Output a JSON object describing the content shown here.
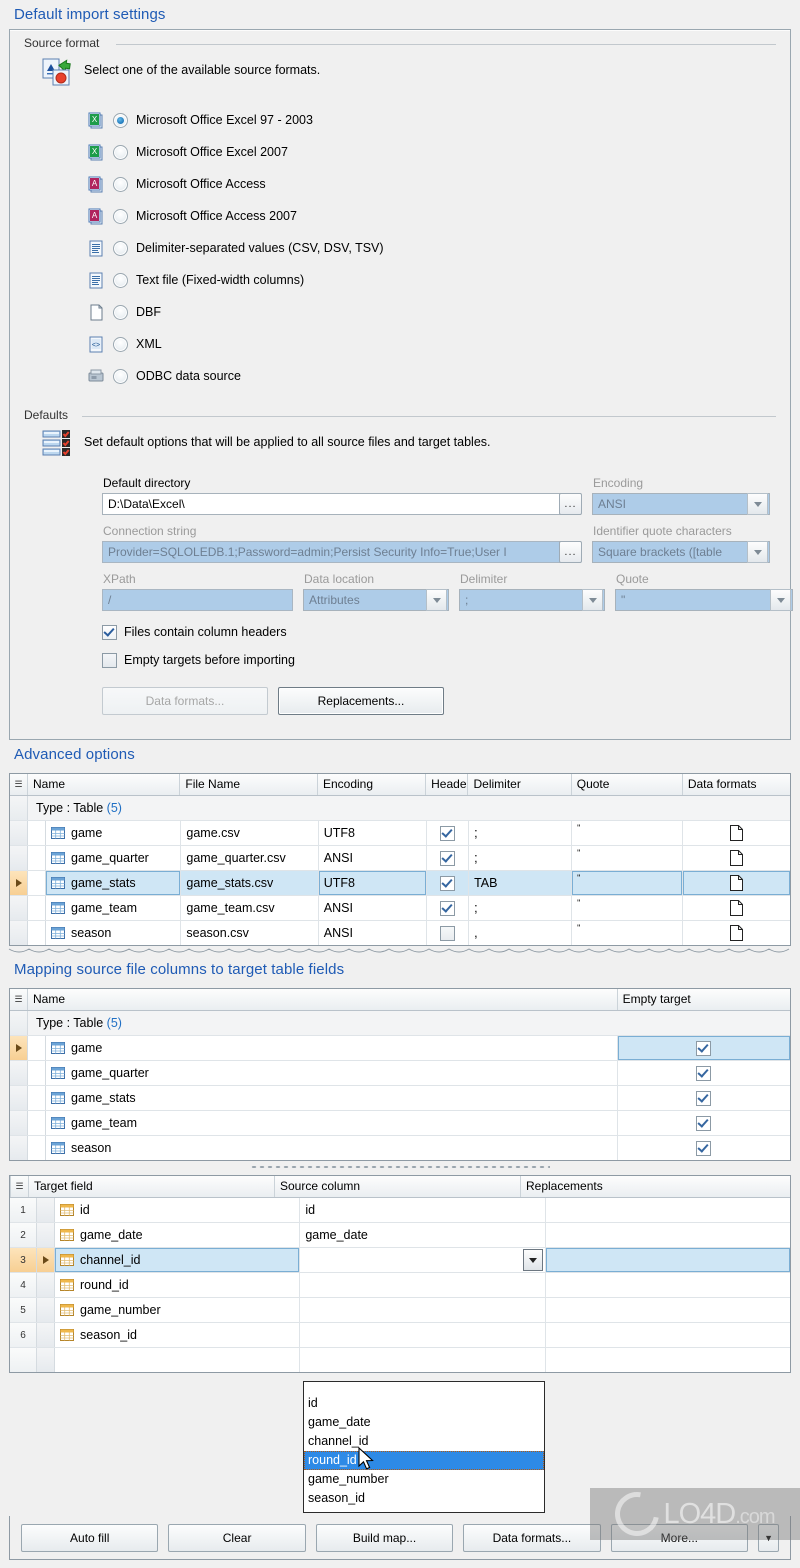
{
  "page": {
    "title": "Default import settings",
    "advanced_title": "Advanced options",
    "mapping_title": "Mapping source file columns to target table fields"
  },
  "source_format": {
    "group_label": "Source format",
    "hint": "Select one of the available source formats.",
    "options": [
      {
        "label": "Microsoft Office Excel 97 - 2003",
        "icon": "excel-icon",
        "selected": true
      },
      {
        "label": "Microsoft Office Excel 2007",
        "icon": "excel-icon",
        "selected": false
      },
      {
        "label": "Microsoft Office Access",
        "icon": "access-icon",
        "selected": false
      },
      {
        "label": "Microsoft Office Access 2007",
        "icon": "access-icon",
        "selected": false
      },
      {
        "label": "Delimiter-separated values (CSV, DSV, TSV)",
        "icon": "textfile-icon",
        "selected": false
      },
      {
        "label": "Text file (Fixed-width columns)",
        "icon": "textfile-icon",
        "selected": false
      },
      {
        "label": "DBF",
        "icon": "blankfile-icon",
        "selected": false
      },
      {
        "label": "XML",
        "icon": "xml-icon",
        "selected": false
      },
      {
        "label": "ODBC data source",
        "icon": "odbc-icon",
        "selected": false
      }
    ]
  },
  "defaults": {
    "group_label": "Defaults",
    "hint": "Set default options that will be applied to all source files and target tables.",
    "default_directory": {
      "label": "Default directory",
      "value": "D:\\Data\\Excel\\",
      "browse": "..."
    },
    "encoding": {
      "label": "Encoding",
      "value": "ANSI"
    },
    "connection_string": {
      "label": "Connection string",
      "value": "Provider=SQLOLEDB.1;Password=admin;Persist Security Info=True;User I",
      "browse": "..."
    },
    "identifier_quote": {
      "label": "Identifier quote characters",
      "value": "Square brackets ([table"
    },
    "xpath": {
      "label": "XPath",
      "value": "/"
    },
    "data_location": {
      "label": "Data location",
      "value": "Attributes"
    },
    "delimiter": {
      "label": "Delimiter",
      "value": ";"
    },
    "quote": {
      "label": "Quote",
      "value": "\""
    },
    "checkbox_headers": {
      "label": "Files contain column headers",
      "checked": true
    },
    "checkbox_empty": {
      "label": "Empty targets before importing",
      "checked": false
    },
    "button_data_formats": "Data formats...",
    "button_replacements": "Replacements..."
  },
  "advanced_grid": {
    "columns": [
      "Name",
      "File Name",
      "Encoding",
      "Heade",
      "Delimiter",
      "Quote",
      "Data formats"
    ],
    "group_row": {
      "text": "Type : Table",
      "count": "(5)"
    },
    "rows": [
      {
        "name": "game",
        "file": "game.csv",
        "encoding": "UTF8",
        "header": true,
        "delimiter": ";",
        "quote": "\"",
        "selected": false
      },
      {
        "name": "game_quarter",
        "file": "game_quarter.csv",
        "encoding": "ANSI",
        "header": true,
        "delimiter": ";",
        "quote": "\"",
        "selected": false
      },
      {
        "name": "game_stats",
        "file": "game_stats.csv",
        "encoding": "UTF8",
        "header": true,
        "delimiter": "TAB",
        "quote": "\"",
        "selected": true
      },
      {
        "name": "game_team",
        "file": "game_team.csv",
        "encoding": "ANSI",
        "header": true,
        "delimiter": ";",
        "quote": "\"",
        "selected": false
      },
      {
        "name": "season",
        "file": "season.csv",
        "encoding": "ANSI",
        "header": false,
        "delimiter": ",",
        "quote": "\"",
        "selected": false
      }
    ]
  },
  "mapping_grid": {
    "columns": [
      "Name",
      "Empty target"
    ],
    "group_row": {
      "text": "Type : Table",
      "count": "(5)"
    },
    "rows": [
      {
        "name": "game",
        "empty_target": true,
        "selected": true
      },
      {
        "name": "game_quarter",
        "empty_target": true,
        "selected": false
      },
      {
        "name": "game_stats",
        "empty_target": true,
        "selected": false
      },
      {
        "name": "game_team",
        "empty_target": true,
        "selected": false
      },
      {
        "name": "season",
        "empty_target": true,
        "selected": false
      }
    ]
  },
  "field_grid": {
    "columns": [
      "Target field",
      "Source column",
      "Replacements"
    ],
    "rows": [
      {
        "num": "1",
        "target": "id",
        "source": "id",
        "replacements": "",
        "selected": false
      },
      {
        "num": "2",
        "target": "game_date",
        "source": "game_date",
        "replacements": "",
        "selected": false
      },
      {
        "num": "3",
        "target": "channel_id",
        "source": "",
        "replacements": "",
        "selected": true
      },
      {
        "num": "4",
        "target": "round_id",
        "source": "",
        "replacements": "",
        "selected": false
      },
      {
        "num": "5",
        "target": "game_number",
        "source": "",
        "replacements": "",
        "selected": false
      },
      {
        "num": "6",
        "target": "season_id",
        "source": "",
        "replacements": "",
        "selected": false
      }
    ],
    "dropdown": {
      "open": true,
      "items": [
        "id",
        "game_date",
        "channel_id",
        "round_id",
        "game_number",
        "season_id"
      ],
      "highlighted": "round_id"
    }
  },
  "bottom_bar": {
    "buttons": [
      {
        "label": "Auto fill",
        "accel": "fi"
      },
      {
        "label": "Clear",
        "accel": "C"
      },
      {
        "label": "Build map...",
        "accel": "u"
      },
      {
        "label": "Data formats...",
        "accel": ""
      },
      {
        "label": "More...",
        "accel": "M"
      }
    ],
    "dropdown_arrow": "▼"
  },
  "watermark": {
    "text": "LO4D",
    "suffix": ".com"
  },
  "colors": {
    "heading": "#1f5bb5",
    "selection": "#cfe6f5",
    "disabled_field": "#aecce8",
    "dropdown_highlight": "#2e8ae6"
  }
}
